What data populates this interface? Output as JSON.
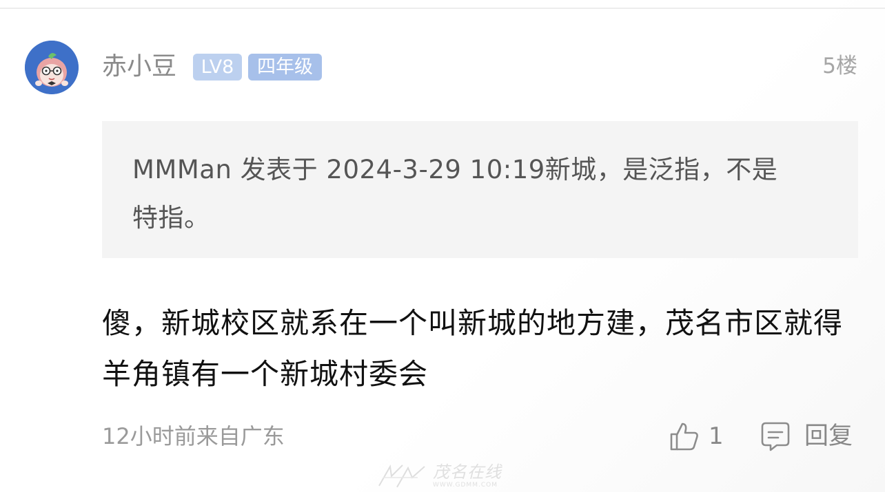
{
  "post": {
    "username": "赤小豆",
    "level_badge": "LV8",
    "grade_badge": "四年级",
    "floor": "5楼",
    "quote": {
      "text": "MMMan 发表于 2024-3-29 10:19新城，是泛指，不是特指。"
    },
    "content": "傻，新城校区就系在一个叫新城的地方建，茂名市区就得羊角镇有一个新城村委会",
    "meta": "12小时前来自广东",
    "actions": {
      "like_count": "1",
      "reply_label": "回复"
    }
  },
  "watermark": {
    "brand_text": "茂名在线",
    "url_text": "WWW.GDMM.COM"
  },
  "colors": {
    "avatar_bg": "#3e70c8",
    "badge_bg": "#bcd0ef",
    "quote_bg": "#f4f4f4"
  },
  "icons": [
    "avatar-icon",
    "thumbs-up-icon",
    "comment-icon",
    "watermark-logo-icon"
  ]
}
